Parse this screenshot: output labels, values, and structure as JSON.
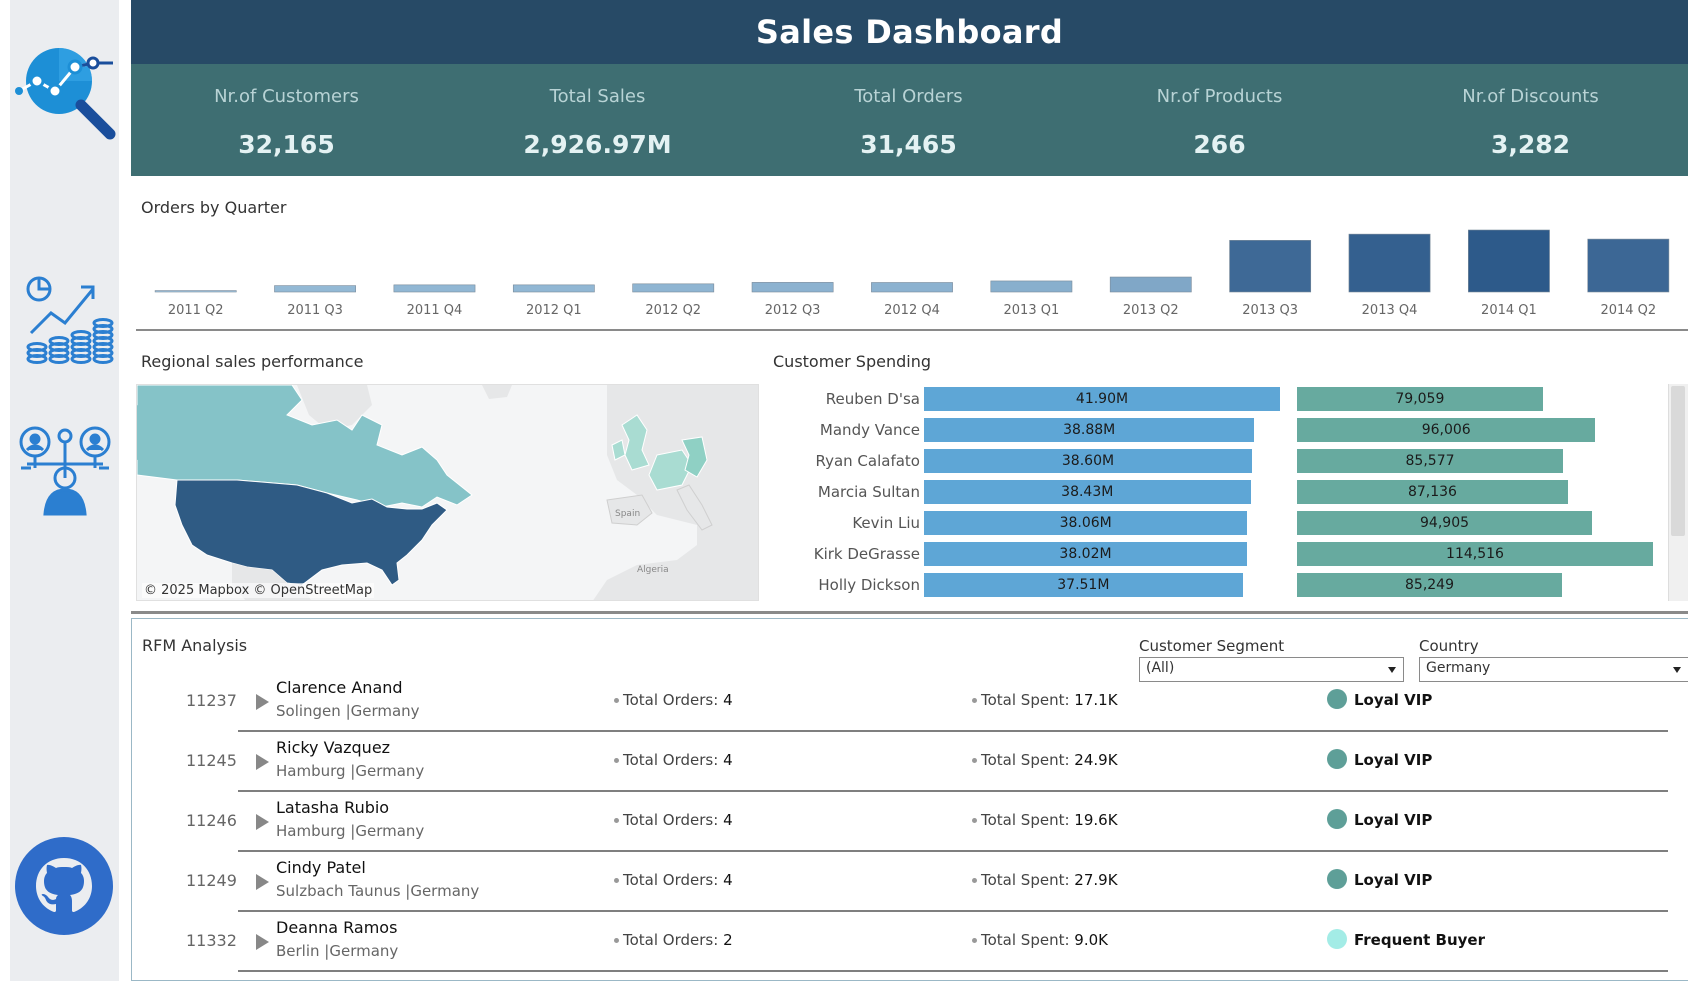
{
  "header": {
    "title": "Sales Dashboard"
  },
  "kpis": [
    {
      "label": "Nr.of Customers",
      "value": "32,165"
    },
    {
      "label": "Total Sales",
      "value": "2,926.97M"
    },
    {
      "label": "Total Orders",
      "value": "31,465"
    },
    {
      "label": "Nr.of Products",
      "value": "266"
    },
    {
      "label": "Nr.of Discounts",
      "value": "3,282"
    }
  ],
  "orders_section": {
    "title": "Orders by Quarter"
  },
  "chart_data": {
    "type": "bar",
    "categories": [
      "2011 Q2",
      "2011 Q3",
      "2011 Q4",
      "2012 Q1",
      "2012 Q2",
      "2012 Q3",
      "2012 Q4",
      "2013 Q1",
      "2013 Q2",
      "2013 Q3",
      "2013 Q4",
      "2014 Q1",
      "2014 Q2"
    ],
    "values": [
      140,
      620,
      690,
      690,
      790,
      930,
      920,
      1070,
      1450,
      5000,
      5600,
      6000,
      5120
    ],
    "xlabel": "",
    "ylabel": "",
    "grid": false,
    "colors": {
      "low": "#a7cbe4",
      "high": "#2d5a8a"
    }
  },
  "map_section": {
    "title": "Regional sales performance",
    "credit": "© 2025 Mapbox  © OpenStreetMap",
    "labels": {
      "spain": "Spain",
      "algeria": "Algeria"
    },
    "colors": {
      "usa": "#2f5b84",
      "canada": "#85c3c8",
      "europe_light": "#a9dcd2",
      "europe_mid": "#8fd0c4",
      "land": "#e6e7e8",
      "water": "#f4f5f6"
    }
  },
  "spending": {
    "title": "Customer Spending",
    "colors": {
      "sales": "#5ea6d6",
      "orders": "#67aa9f"
    },
    "customers": [
      {
        "name": "Reuben D'sa",
        "sales": 41.9,
        "sales_label": "41.90M",
        "value2": 79059,
        "value2_label": "79,059"
      },
      {
        "name": "Mandy Vance",
        "sales": 38.88,
        "sales_label": "38.88M",
        "value2": 96006,
        "value2_label": "96,006"
      },
      {
        "name": "Ryan Calafato",
        "sales": 38.6,
        "sales_label": "38.60M",
        "value2": 85577,
        "value2_label": "85,577"
      },
      {
        "name": "Marcia Sultan",
        "sales": 38.43,
        "sales_label": "38.43M",
        "value2": 87136,
        "value2_label": "87,136"
      },
      {
        "name": "Kevin Liu",
        "sales": 38.06,
        "sales_label": "38.06M",
        "value2": 94905,
        "value2_label": "94,905"
      },
      {
        "name": "Kirk DeGrasse",
        "sales": 38.02,
        "sales_label": "38.02M",
        "value2": 114516,
        "value2_label": "114,516"
      },
      {
        "name": "Holly Dickson",
        "sales": 37.51,
        "sales_label": "37.51M",
        "value2": 85249,
        "value2_label": "85,249"
      }
    ]
  },
  "rfm": {
    "title": "RFM Analysis",
    "filters": {
      "segment_label": "Customer Segment",
      "segment_value": "(All)",
      "country_label": "Country",
      "country_value": "Germany"
    },
    "orders_prefix": "Total Orders:",
    "spent_prefix": "Total Spent:",
    "rows": [
      {
        "id": "11237",
        "name": "Clarence Anand",
        "location": "Solingen |Germany",
        "orders": "4",
        "spent": "17.1K",
        "segment": "Loyal VIP",
        "seg_color": "#5e9f98"
      },
      {
        "id": "11245",
        "name": "Ricky Vazquez",
        "location": "Hamburg |Germany",
        "orders": "4",
        "spent": "24.9K",
        "segment": "Loyal VIP",
        "seg_color": "#5e9f98"
      },
      {
        "id": "11246",
        "name": "Latasha Rubio",
        "location": "Hamburg |Germany",
        "orders": "4",
        "spent": "19.6K",
        "segment": "Loyal VIP",
        "seg_color": "#5e9f98"
      },
      {
        "id": "11249",
        "name": "Cindy Patel",
        "location": "Sulzbach Taunus |Germany",
        "orders": "4",
        "spent": "27.9K",
        "segment": "Loyal VIP",
        "seg_color": "#5e9f98"
      },
      {
        "id": "11332",
        "name": "Deanna Ramos",
        "location": "Berlin |Germany",
        "orders": "2",
        "spent": "9.0K",
        "segment": "Frequent Buyer",
        "seg_color": "#a3ece6"
      }
    ]
  },
  "sidebar": {
    "icons": [
      "analytics-search-icon",
      "financial-growth-icon",
      "customer-balance-icon",
      "github-icon"
    ],
    "colors": {
      "primary": "#2b7fd1",
      "accent": "#1a9bd8",
      "github": "#2f6cc9"
    }
  }
}
